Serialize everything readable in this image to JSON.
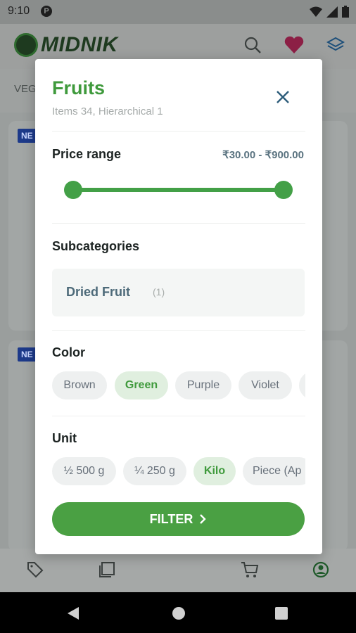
{
  "status_bar": {
    "time": "9:10",
    "notification_badge": "P"
  },
  "app_bar": {
    "logo_text": "MIDNIK"
  },
  "background": {
    "tab_partial": "VEG",
    "badge_partial": "NE"
  },
  "dialog": {
    "title": "Fruits",
    "subtitle": "Items 34, Hierarchical 1",
    "price": {
      "label": "Price range",
      "value": "₹30.00 - ₹900.00",
      "range_min_fraction": 0.0,
      "range_max_fraction": 1.0
    },
    "subcategories": {
      "label": "Subcategories",
      "items": [
        {
          "name": "Dried Fruit",
          "count": "(1)"
        }
      ]
    },
    "color": {
      "label": "Color",
      "chips": [
        {
          "label": "Brown",
          "selected": false
        },
        {
          "label": "Green",
          "selected": true
        },
        {
          "label": "Purple",
          "selected": false
        },
        {
          "label": "Violet",
          "selected": false
        },
        {
          "label": "",
          "selected": false
        }
      ]
    },
    "unit": {
      "label": "Unit",
      "chips": [
        {
          "label": "½ 500 g",
          "selected": false
        },
        {
          "label": "¼ 250 g",
          "selected": false
        },
        {
          "label": "Kilo",
          "selected": true
        },
        {
          "label": "Piece (Ap",
          "selected": false
        }
      ]
    },
    "filter_button": {
      "label": "FILTER"
    }
  },
  "colors": {
    "accent": "#43a047",
    "title_green": "#3f9a3c",
    "selected_chip_bg": "#e0efdf",
    "heart": "#c2185b"
  }
}
